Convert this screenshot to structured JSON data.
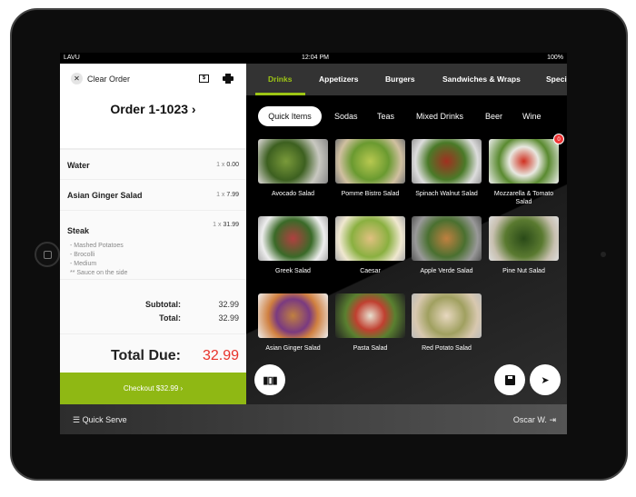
{
  "status": {
    "carrier": "LAVU",
    "time": "12:04 PM",
    "battery": "100%"
  },
  "order": {
    "clear_label": "Clear Order",
    "title": "Order 1-1023 ›",
    "items": [
      {
        "name": "Water",
        "qty": "1 x",
        "price": "0.00"
      },
      {
        "name": "Asian Ginger Salad",
        "qty": "1 x",
        "price": "7.99"
      },
      {
        "name": "Steak",
        "qty": "1 x",
        "price": "31.99",
        "mods": [
          "- Mashed Potatoes",
          "- Brocolli",
          "- Medium",
          "** Sauce on the side"
        ]
      }
    ],
    "subtotal_label": "Subtotal:",
    "subtotal": "32.99",
    "total_label": "Total:",
    "total": "32.99",
    "due_label": "Total Due:",
    "due": "32.99",
    "due_color": "#e8322a",
    "checkout_label": "Checkout $32.99 ›"
  },
  "categories": [
    {
      "label": "Drinks",
      "active": true
    },
    {
      "label": "Appetizers"
    },
    {
      "label": "Burgers"
    },
    {
      "label": "Sandwiches & Wraps"
    },
    {
      "label": "Speci"
    }
  ],
  "subcategories": [
    {
      "label": "Quick Items",
      "active": true
    },
    {
      "label": "Sodas"
    },
    {
      "label": "Teas"
    },
    {
      "label": "Mixed Drinks"
    },
    {
      "label": "Beer"
    },
    {
      "label": "Wine"
    }
  ],
  "menu_items": [
    {
      "label": "Avocado Salad"
    },
    {
      "label": "Pomme Bistro Salad"
    },
    {
      "label": "Spinach Walnut Salad"
    },
    {
      "label": "Mozzarella & Tomato Salad",
      "badge": "0"
    },
    {
      "label": "Greek Salad"
    },
    {
      "label": "Caesar"
    },
    {
      "label": "Apple Verde Salad"
    },
    {
      "label": "Pine Nut Salad"
    },
    {
      "label": "Asian Ginger Salad"
    },
    {
      "label": "Pasta Salad"
    },
    {
      "label": "Red Potato Salad"
    }
  ],
  "footer": {
    "mode": "Quick Serve",
    "user": "Oscar W."
  },
  "accent": "#8fb814"
}
